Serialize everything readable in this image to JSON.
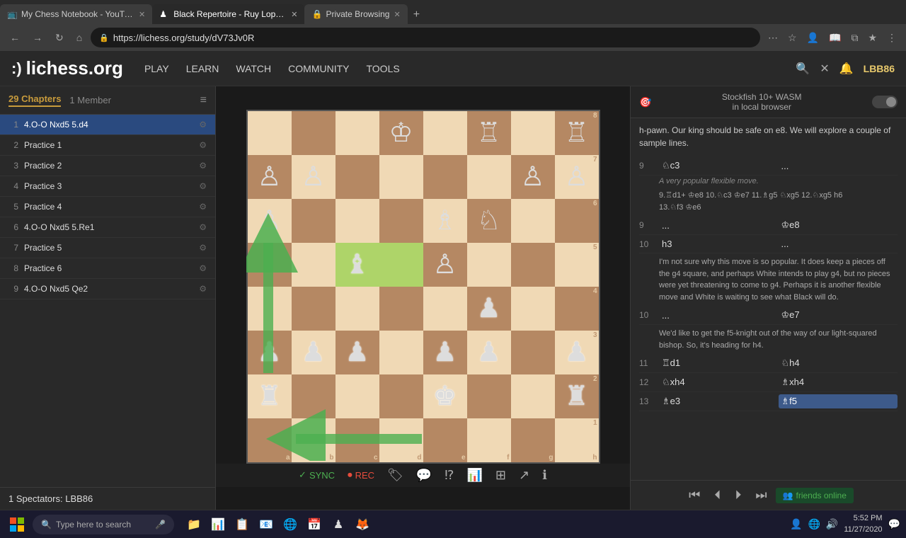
{
  "browser": {
    "tabs": [
      {
        "id": "tab1",
        "title": "My Chess Notebook - YouTube",
        "favicon": "📺",
        "active": false
      },
      {
        "id": "tab2",
        "title": "Black Repertoire - Ruy Lopez: B...",
        "favicon": "♟",
        "active": true
      },
      {
        "id": "tab3",
        "title": "Private Browsing",
        "favicon": "🔒",
        "active": false
      }
    ],
    "url": "https://lichess.org/study/dV73Jv0R"
  },
  "lichess": {
    "logo": "lichess.org",
    "logo_emoji": ":)",
    "nav_links": [
      "PLAY",
      "LEARN",
      "WATCH",
      "COMMUNITY",
      "TOOLS"
    ],
    "username": "LBB86"
  },
  "chapters": {
    "tab_chapters": "29 Chapters",
    "tab_members": "1 Member",
    "items": [
      {
        "num": "1",
        "name": "4.O-O Nxd5 5.d4",
        "active": true
      },
      {
        "num": "2",
        "name": "Practice 1",
        "active": false
      },
      {
        "num": "3",
        "name": "Practice 2",
        "active": false
      },
      {
        "num": "4",
        "name": "Practice 3",
        "active": false
      },
      {
        "num": "5",
        "name": "Practice 4",
        "active": false
      },
      {
        "num": "6",
        "name": "4.O-O Nxd5 5.Re1",
        "active": false
      },
      {
        "num": "7",
        "name": "Practice 5",
        "active": false
      },
      {
        "num": "8",
        "name": "Practice 6",
        "active": false
      },
      {
        "num": "9",
        "name": "4.O-O Nxd5 Qe2",
        "active": false
      }
    ]
  },
  "analysis": {
    "engine_name": "Stockfish 10+ WASM\nin local browser",
    "intro_text": "h-pawn. Our king should be safe on e8. We will explore a couple of sample lines.",
    "moves": [
      {
        "num": "9",
        "white": "♘c3",
        "black": "...",
        "comment": "A very popular flexible move.",
        "annotation": "9.♖d1+ ♔e8 10.♘c3 ♔e7 11.♗g5 ♘xg5 12.♘xg5 h6\n13.♘f3 ♔e6"
      },
      {
        "num": "9",
        "white": "...",
        "black": "♔e8",
        "comment": "",
        "annotation": ""
      },
      {
        "num": "10",
        "white": "h3",
        "black": "...",
        "comment": "",
        "annotation": "I'm not sure why this move is so popular. It does keep a pieces off the g4 square, and perhaps White intends to play g4, but no pieces were yet threatening to come to g4. Perhaps it is another flexible move and White is waiting to see what Black will do."
      },
      {
        "num": "10",
        "white": "...",
        "black": "♔e7",
        "comment": "",
        "annotation": "We'd like to get the f5-knight out of the way of our light-squared bishop. So, it's heading for h4."
      },
      {
        "num": "11",
        "white": "♖d1",
        "black": "♘h4",
        "comment": "",
        "annotation": ""
      },
      {
        "num": "12",
        "white": "♘xh4",
        "black": "♗xh4",
        "comment": "",
        "annotation": ""
      },
      {
        "num": "13",
        "white": "♗e3",
        "black": "♗f5",
        "highlighted": true,
        "comment": "",
        "annotation": ""
      }
    ]
  },
  "board_toolbar": {
    "sync_label": "SYNC",
    "rec_label": "REC"
  },
  "spectators": "1 Spectators: LBB86",
  "friends_btn": "friends online",
  "taskbar": {
    "time": "5:52 PM",
    "date": "11/27/2020",
    "search_placeholder": "Type here to search"
  }
}
